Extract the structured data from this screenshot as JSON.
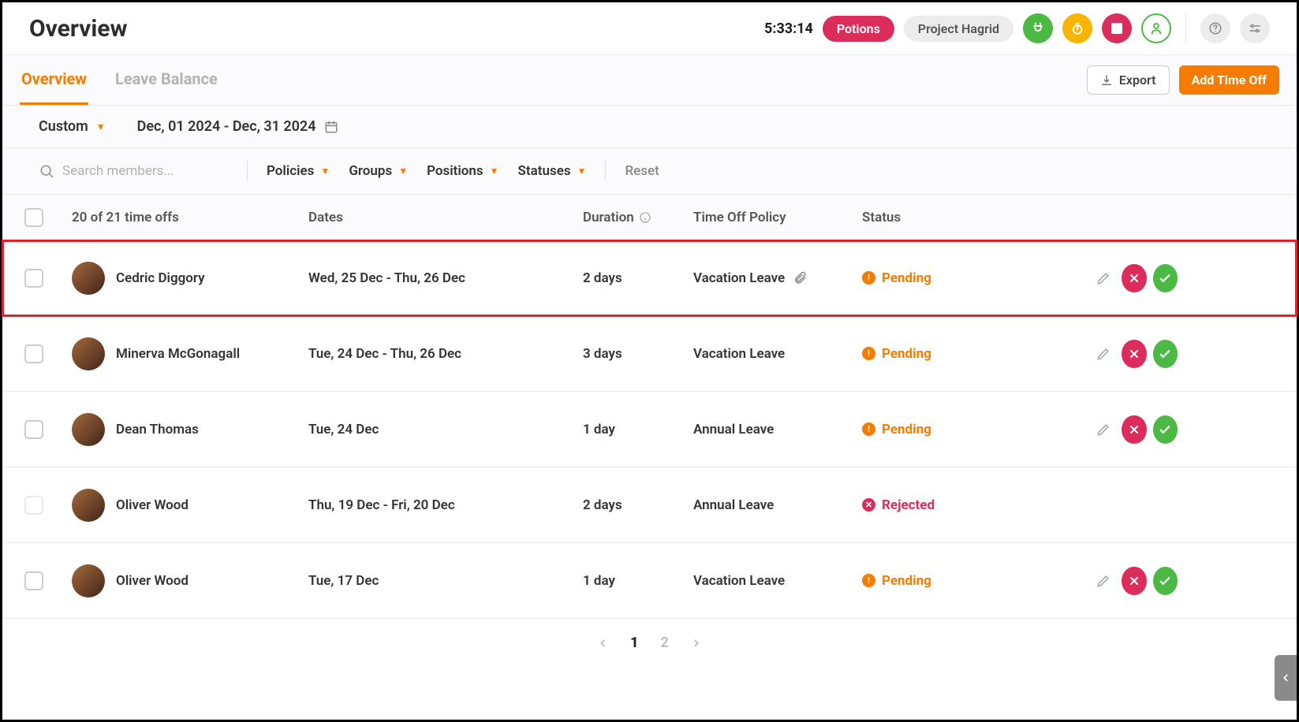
{
  "header": {
    "title": "Overview",
    "timer": "5:33:14",
    "pill_potions": "Potions",
    "pill_project": "Project Hagrid"
  },
  "tabs": {
    "overview": "Overview",
    "leave_balance": "Leave Balance"
  },
  "actions": {
    "export": "Export",
    "add": "Add Time Off"
  },
  "range": {
    "label": "Custom",
    "dates": "Dec, 01 2024 - Dec, 31 2024"
  },
  "filters": {
    "search_placeholder": "Search members...",
    "policies": "Policies",
    "groups": "Groups",
    "positions": "Positions",
    "statuses": "Statuses",
    "reset": "Reset"
  },
  "table": {
    "count_label": "20 of 21 time offs",
    "columns": {
      "dates": "Dates",
      "duration": "Duration",
      "policy": "Time Off Policy",
      "status": "Status"
    },
    "rows": [
      {
        "name": "Cedric Diggory",
        "dates": "Wed, 25 Dec - Thu, 26 Dec",
        "duration": "2 days",
        "policy": "Vacation Leave",
        "attachment": true,
        "status": "Pending",
        "highlighted": true,
        "actions": true,
        "disabled": false
      },
      {
        "name": "Minerva McGonagall",
        "dates": "Tue, 24 Dec - Thu, 26 Dec",
        "duration": "3 days",
        "policy": "Vacation Leave",
        "attachment": false,
        "status": "Pending",
        "highlighted": false,
        "actions": true,
        "disabled": false
      },
      {
        "name": "Dean Thomas",
        "dates": "Tue, 24 Dec",
        "duration": "1 day",
        "policy": "Annual Leave",
        "attachment": false,
        "status": "Pending",
        "highlighted": false,
        "actions": true,
        "disabled": false
      },
      {
        "name": "Oliver Wood",
        "dates": "Thu, 19 Dec - Fri, 20 Dec",
        "duration": "2 days",
        "policy": "Annual Leave",
        "attachment": false,
        "status": "Rejected",
        "highlighted": false,
        "actions": false,
        "disabled": true
      },
      {
        "name": "Oliver Wood",
        "dates": "Tue, 17 Dec",
        "duration": "1 day",
        "policy": "Vacation Leave",
        "attachment": false,
        "status": "Pending",
        "highlighted": false,
        "actions": true,
        "disabled": false
      }
    ]
  },
  "pagination": {
    "page1": "1",
    "page2": "2"
  }
}
